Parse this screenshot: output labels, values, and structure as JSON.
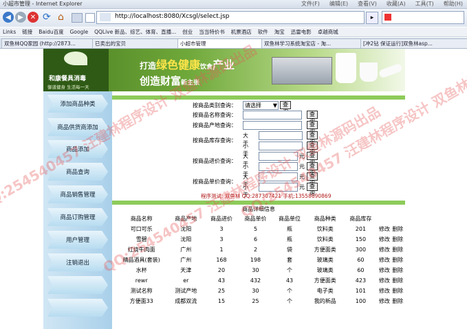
{
  "browser": {
    "window_title": "小超市管理 - Internet Explorer",
    "menu": [
      "文件(F)",
      "编辑(E)",
      "查看(V)",
      "收藏(A)",
      "工具(T)",
      "帮助(H)"
    ],
    "url": "http://localhost:8080/Xcsgl/select.jsp",
    "links_label": "Links",
    "links": [
      "链接",
      "Baidu百度",
      "Google",
      "QQLive 新品、综艺、体育、直播...",
      "创业",
      "当当特价书",
      "机票酒店",
      "软件",
      "淘宝",
      "迅雷电影",
      "卓越商城"
    ],
    "tabs": [
      {
        "label": "双鱼林QQ家园 (http://2873...",
        "active": false
      },
      {
        "label": "已卖出的宝贝",
        "active": false
      },
      {
        "label": "小超市管理",
        "active": true
      },
      {
        "label": "双鱼林学习系统淘宝店 - 淘...",
        "active": false
      },
      {
        "label": "[冲2钻 保证运行]双鱼林asp...",
        "active": false
      }
    ]
  },
  "banner": {
    "logo_name": "和康餐具消毒",
    "logo_slogan": "御道健身 生活每一天",
    "line1_prefix": "打造",
    "line1_highlight": "绿色健康",
    "line1_mid": "饮食",
    "line1_suffix": "产业",
    "line2": "创造财富",
    "line2_small": "新主张"
  },
  "sidebar": {
    "items": [
      "添加商品种类",
      "商品供货商添加",
      "商品添加",
      "商品查询",
      "商品销售管理",
      "商品订购管理",
      "用户管理",
      "注销退出"
    ]
  },
  "query": {
    "category_label": "按商品类别查询：",
    "category_select": "请选择",
    "name_label": "按商品名称查询：",
    "origin_label": "按商品产地查询：",
    "stock_label": "按商品库存查询：",
    "purchase_label": "按商品进价查询：",
    "price_label": "按商品单价查询：",
    "greater": "大于",
    "less": "小于",
    "unit_yuan": "元",
    "button": "查询"
  },
  "footer_note": "程序测试: 双鱼林 QQ:287307421 手机:13558690869",
  "table": {
    "title": "商品详细信息",
    "headers": [
      "商品名称",
      "商品产地",
      "商品进价",
      "商品单价",
      "商品单位",
      "商品种类",
      "商品库存"
    ],
    "edit": "修改",
    "delete": "删除",
    "rows": [
      [
        "可口可乐",
        "沈阳",
        "3",
        "5",
        "瓶",
        "饮料类",
        "201"
      ],
      [
        "雪碧",
        "沈阳",
        "3",
        "6",
        "瓶",
        "饮料类",
        "150"
      ],
      [
        "红烧牛肉面",
        "广州",
        "1",
        "2",
        "袋",
        "方便面类",
        "300"
      ],
      [
        "精品酒具(套装)",
        "广州",
        "168",
        "198",
        "套",
        "玻璃类",
        "60"
      ],
      [
        "水杯",
        "天津",
        "20",
        "30",
        "个",
        "玻璃类",
        "60"
      ],
      [
        "rewr",
        "er",
        "43",
        "432",
        "43",
        "方便面类",
        "423"
      ],
      [
        "测试名称",
        "测试产地",
        "25",
        "30",
        "个",
        "电子类",
        "101"
      ],
      [
        "方便面33",
        "成都双流",
        "15",
        "25",
        "个",
        "我的新品",
        "100"
      ]
    ]
  },
  "watermark": "QQ:254540457 汪建林程序设计 双鱼林源码出品",
  "colors": {
    "green": "#8dcb5a",
    "sidebar": "#a9d0ea",
    "watermark": "#e65a5a"
  }
}
